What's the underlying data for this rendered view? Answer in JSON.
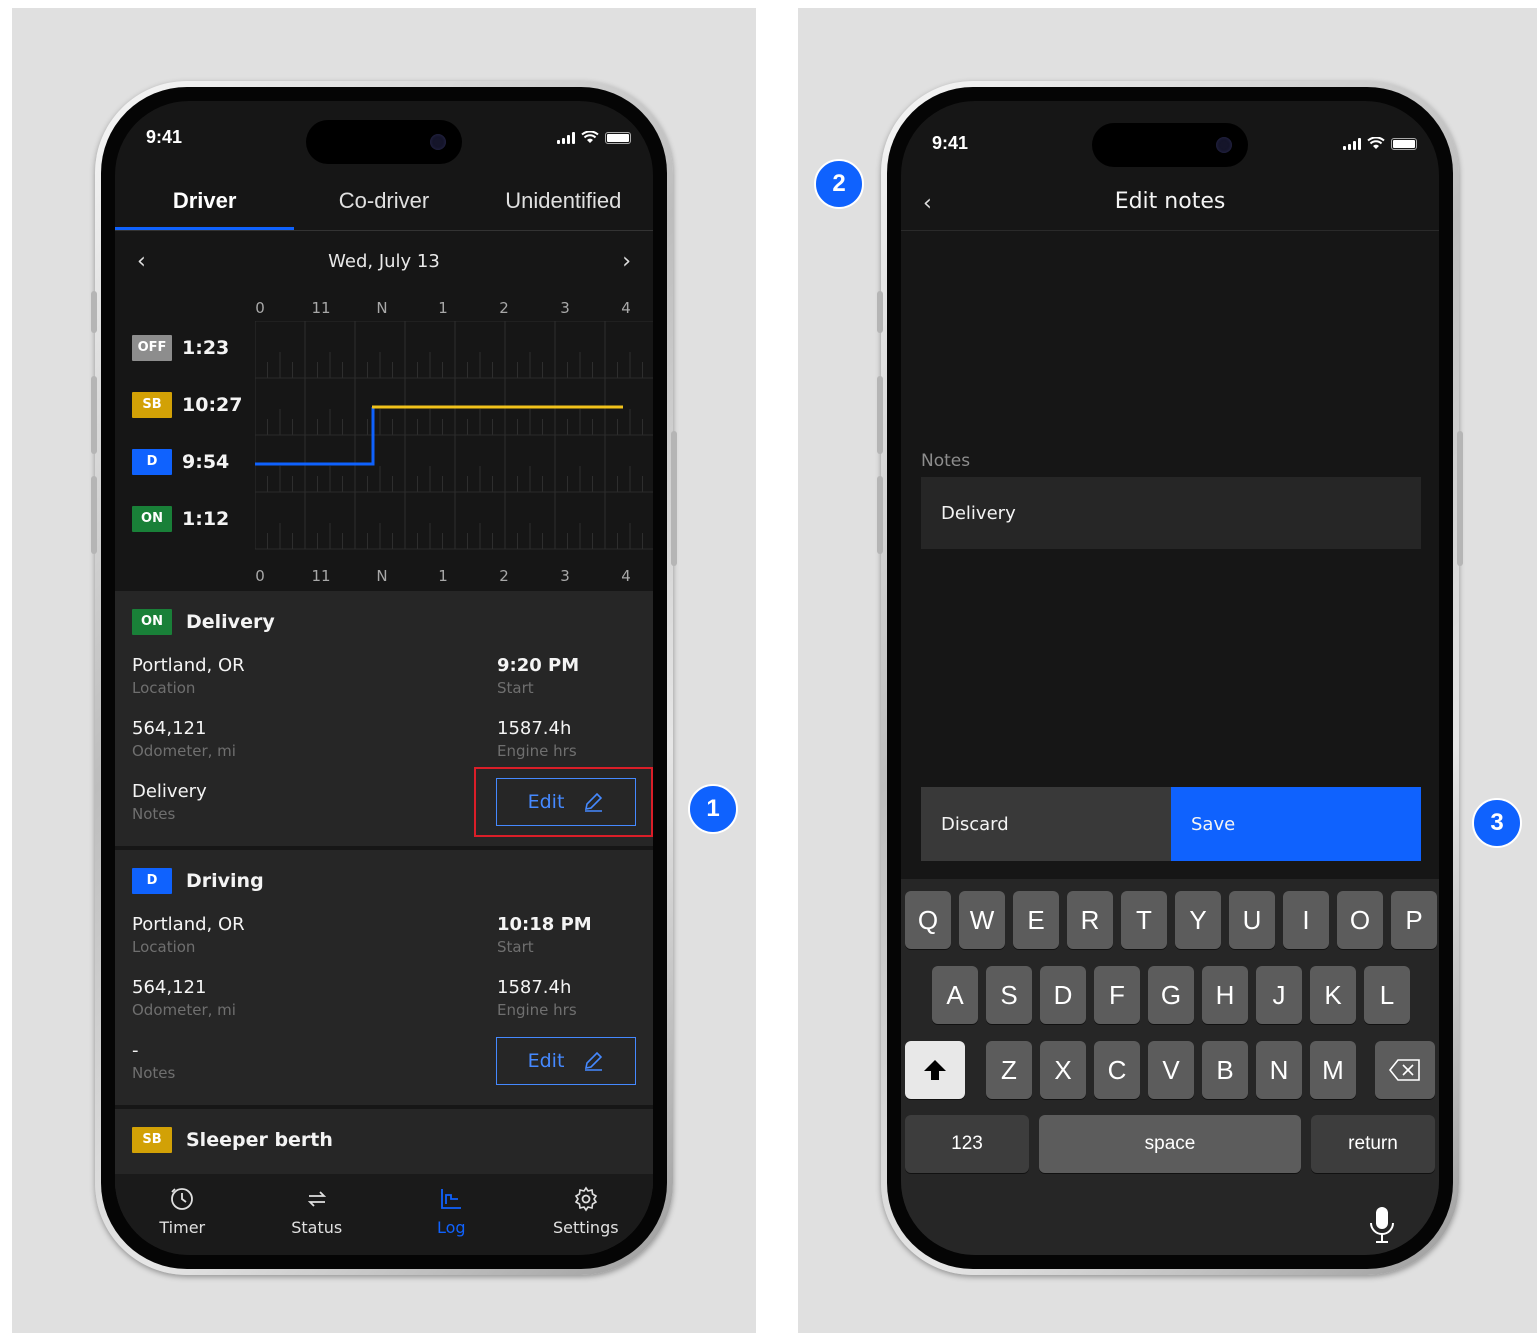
{
  "left_phone": {
    "status_bar": {
      "time": "9:41"
    },
    "tabs": [
      {
        "label": "Driver",
        "active": true
      },
      {
        "label": "Co-driver",
        "active": false
      },
      {
        "label": "Unidentified",
        "active": false
      }
    ],
    "date_nav": {
      "date": "Wed, July 13",
      "prev_icon": "chevron-left-icon",
      "next_icon": "chevron-right-icon"
    },
    "log_chart": {
      "hour_ticks": [
        "0",
        "11",
        "N",
        "1",
        "2",
        "3",
        "4"
      ],
      "rows": [
        {
          "tag": "OFF",
          "duration": "1:23",
          "color": "#8d8d8d"
        },
        {
          "tag": "SB",
          "duration": "10:27",
          "color": "#d2a106"
        },
        {
          "tag": "D",
          "duration": "9:54",
          "color": "#0f62fe"
        },
        {
          "tag": "ON",
          "duration": "1:12",
          "color": "#198038"
        }
      ]
    },
    "events": [
      {
        "tag": "ON",
        "title": "Delivery",
        "location": "Portland, OR",
        "location_label": "Location",
        "start": "9:20 PM",
        "start_label": "Start",
        "odometer": "564,121",
        "odometer_label": "Odometer, mi",
        "engine": "1587.4h",
        "engine_label": "Engine hrs",
        "notes": "Delivery",
        "notes_label": "Notes",
        "edit_label": "Edit"
      },
      {
        "tag": "D",
        "title": "Driving",
        "location": "Portland, OR",
        "location_label": "Location",
        "start": "10:18 PM",
        "start_label": "Start",
        "odometer": "564,121",
        "odometer_label": "Odometer, mi",
        "engine": "1587.4h",
        "engine_label": "Engine hrs",
        "notes": "-",
        "notes_label": "Notes",
        "edit_label": "Edit"
      },
      {
        "tag": "SB",
        "title": "Sleeper berth"
      }
    ],
    "bottom_tabs": [
      {
        "label": "Timer",
        "icon": "timer-icon",
        "active": false
      },
      {
        "label": "Status",
        "icon": "swap-icon",
        "active": false
      },
      {
        "label": "Log",
        "icon": "log-chart-icon",
        "active": true
      },
      {
        "label": "Settings",
        "icon": "gear-icon",
        "active": false
      }
    ]
  },
  "right_phone": {
    "status_bar": {
      "time": "9:41"
    },
    "title": "Edit notes",
    "notes_label": "Notes",
    "notes_value": "Delivery",
    "discard_label": "Discard",
    "save_label": "Save",
    "keyboard": {
      "row1": [
        "Q",
        "W",
        "E",
        "R",
        "T",
        "Y",
        "U",
        "I",
        "O",
        "P"
      ],
      "row2": [
        "A",
        "S",
        "D",
        "F",
        "G",
        "H",
        "J",
        "K",
        "L"
      ],
      "row3": [
        "Z",
        "X",
        "C",
        "V",
        "B",
        "N",
        "M"
      ],
      "numbers_label": "123",
      "space_label": "space",
      "return_label": "return"
    }
  },
  "markers": [
    "1",
    "2",
    "3"
  ],
  "colors": {
    "accent": "#0f62fe",
    "highlight": "#da1e28",
    "on": "#198038",
    "sb": "#d2a106",
    "off": "#8d8d8d"
  }
}
